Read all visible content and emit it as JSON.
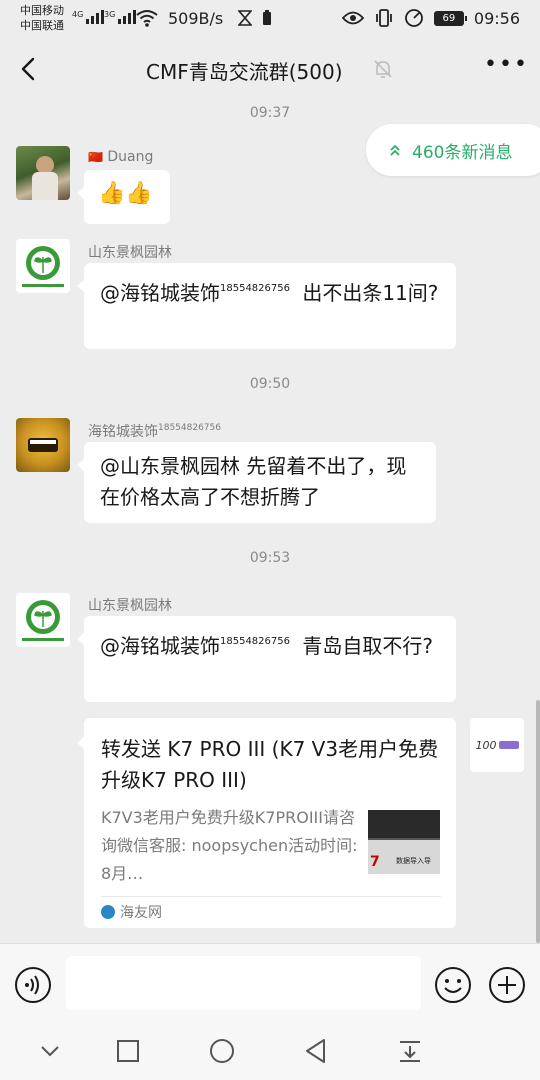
{
  "status_bar": {
    "carrier_1": "中国移动",
    "carrier_2": "中国联通",
    "signal_1_label": "4G",
    "signal_2_label": "3G",
    "net_speed": "509B/s",
    "battery": "69",
    "time": "09:56"
  },
  "title_bar": {
    "title": "CMF青岛交流群(500)",
    "icons": [
      "back-arrow-icon",
      "mute-bell-icon",
      "more-icon"
    ]
  },
  "new_messages": {
    "label": "460条新消息",
    "icon": "double-chevron-up-icon",
    "accent_color": "#2aae67"
  },
  "messages": [
    {
      "time": "09:37"
    },
    {
      "sender_flag": "🇨🇳",
      "sender": "Duang",
      "text": "👍👍"
    },
    {
      "sender": "山东景枫园林",
      "mention": "@海铭城装饰",
      "mention_sup": "18554826756",
      "text_after": " 出不出条11间?"
    },
    {
      "time": "09:50"
    },
    {
      "sender": "海铭城装饰",
      "sender_sup": "18554826756",
      "text": "@山东景枫园林  先留着不出了，现在价格太高了不想折腾了"
    },
    {
      "time": "09:53"
    },
    {
      "sender": "山东景枫园林",
      "mention": "@海铭城装饰",
      "mention_sup": "18554826756",
      "text_after": " 青岛自取不行?"
    }
  ],
  "share_card": {
    "title": "转发送 K7 PRO III (K7 V3老用户免费升级K7 PRO III)",
    "description": "K7V3老用户免费升级K7PROIII请咨询微信客服: noopsychen活动时间: 8月…",
    "source": "海友网",
    "thumb_text": "数据导入导"
  },
  "right_avatar_text": "100"
}
